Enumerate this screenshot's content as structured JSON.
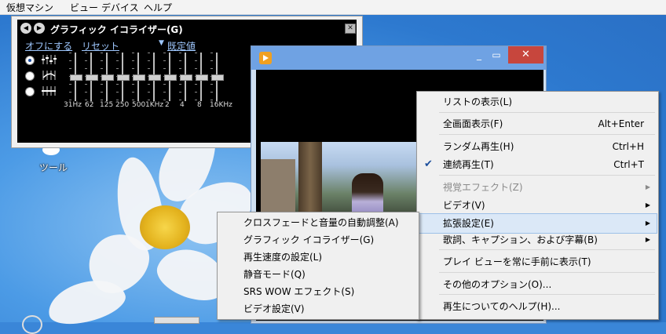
{
  "menubar": {
    "items": [
      "仮想マシン",
      "ビュー",
      "デバイス",
      "ヘルプ"
    ]
  },
  "desktop": {
    "icon_label": "ツール"
  },
  "equalizer": {
    "title": "グラフィック イコライザー(G)",
    "off_link": "オフにする",
    "reset_link": "リセット",
    "preset_link": "既定値",
    "close_glyph": "✕",
    "frequencies": [
      "31Hz",
      "62",
      "125",
      "250",
      "500",
      "1KHz",
      "2",
      "4",
      "8",
      "16KHz"
    ],
    "modes": [
      {
        "checked": true
      },
      {
        "checked": false
      },
      {
        "checked": false
      }
    ]
  },
  "player": {
    "minimize": "_",
    "maximize": "▭",
    "close": "✕"
  },
  "context_menu": {
    "items": [
      {
        "label": "リストの表示(L)",
        "shortcut": "",
        "submenu": false,
        "disabled": false,
        "checked": false
      },
      {
        "label": "全画面表示(F)",
        "shortcut": "Alt+Enter",
        "submenu": false,
        "disabled": false,
        "checked": false
      },
      {
        "label": "ランダム再生(H)",
        "shortcut": "Ctrl+H",
        "submenu": false,
        "disabled": false,
        "checked": false
      },
      {
        "label": "連続再生(T)",
        "shortcut": "Ctrl+T",
        "submenu": false,
        "disabled": false,
        "checked": true
      },
      {
        "label": "視覚エフェクト(Z)",
        "shortcut": "",
        "submenu": true,
        "disabled": true,
        "checked": false
      },
      {
        "label": "ビデオ(V)",
        "shortcut": "",
        "submenu": true,
        "disabled": false,
        "checked": false
      },
      {
        "label": "拡張設定(E)",
        "shortcut": "",
        "submenu": true,
        "disabled": false,
        "checked": false,
        "highlighted": true
      },
      {
        "label": "歌詞、キャプション、および字幕(B)",
        "shortcut": "",
        "submenu": true,
        "disabled": false,
        "checked": false
      },
      {
        "label": "プレイ ビューを常に手前に表示(T)",
        "shortcut": "",
        "submenu": false,
        "disabled": false,
        "checked": false
      },
      {
        "label": "その他のオプション(O)...",
        "shortcut": "",
        "submenu": false,
        "disabled": false,
        "checked": false
      },
      {
        "label": "再生についてのヘルプ(H)...",
        "shortcut": "",
        "submenu": false,
        "disabled": false,
        "checked": false
      }
    ]
  },
  "submenu": {
    "items": [
      "クロスフェードと音量の自動調整(A)",
      "グラフィック イコライザー(G)",
      "再生速度の設定(L)",
      "静音モード(Q)",
      "SRS WOW エフェクト(S)",
      "ビデオ設定(V)"
    ]
  },
  "glyphs": {
    "check": "✔",
    "submenu_arrow": "▶",
    "dropdown_arrow": "▼",
    "prev": "◀",
    "next": "▶"
  }
}
